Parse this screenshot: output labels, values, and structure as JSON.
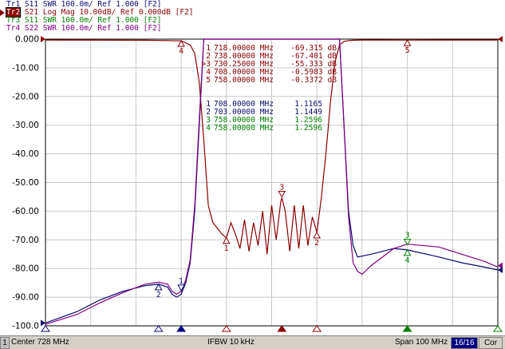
{
  "traces": [
    {
      "id": "Tr1",
      "param": "S11",
      "text": "SWR 100.0m/ Ref 1.000 [F2]",
      "color": "#0a0a6e",
      "active": false
    },
    {
      "id": "Tr2",
      "param": "S21",
      "text": "Log Mag 10.00dB/ Ref 0.000dB [F2]",
      "color": "#8b0000",
      "active": true
    },
    {
      "id": "Tr3",
      "param": "S11",
      "text": "SWR 100.0m/ Ref 1.000 [F2]",
      "color": "#008000",
      "active": false
    },
    {
      "id": "Tr4",
      "param": "S22",
      "text": "SWR 100.0m/ Ref 1.000 [F2]",
      "color": "#800080",
      "active": false
    }
  ],
  "markers_s21": [
    {
      "n": "1",
      "freq": "718.00000 MHz",
      "value": "-69.315 dB"
    },
    {
      "n": "2",
      "freq": "738.00000 MHz",
      "value": "-67.401 dB"
    },
    {
      "n": ">3",
      "freq": "730.25000 MHz",
      "value": "-55.333 dB"
    },
    {
      "n": "4",
      "freq": "708.00000 MHz",
      "value": "-0.5983 dB"
    },
    {
      "n": "5",
      "freq": "758.00000 MHz",
      "value": "-0.3372 dB"
    }
  ],
  "markers_s11": [
    {
      "n": "1",
      "freq": "708.00000 MHz",
      "value": "1.1165",
      "color": "#0a0a6e"
    },
    {
      "n": "2",
      "freq": "703.00000 MHz",
      "value": "1.1449",
      "color": "#0a0a6e"
    },
    {
      "n": "3",
      "freq": "758.00000 MHz",
      "value": "1.2596",
      "color": "#008000"
    },
    {
      "n": "4",
      "freq": "758.00000 MHz",
      "value": "1.2596",
      "color": "#008000"
    }
  ],
  "chart_data": {
    "type": "line",
    "x_range_mhz": [
      678,
      778
    ],
    "ylim": [
      -100,
      0
    ],
    "y_ticks": [
      "0.000",
      "-10.00",
      "-20.00",
      "-30.00",
      "-40.00",
      "-50.00",
      "-60.00",
      "-70.00",
      "-80.00",
      "-90.00",
      "-100.0"
    ],
    "grid": true,
    "series": [
      {
        "name": "Tr2 S21",
        "color": "#8b0000",
        "x": [
          678,
          700,
          705,
          708,
          710,
          711,
          712,
          713,
          714,
          715,
          716,
          717,
          718,
          719,
          720,
          721,
          722,
          723,
          724,
          725,
          726,
          727,
          728,
          729,
          730,
          730.25,
          731,
          732,
          733,
          734,
          735,
          736,
          737,
          738,
          739,
          740,
          741,
          742,
          743,
          744,
          745,
          746,
          748,
          752,
          758,
          765,
          770,
          778
        ],
        "y": [
          -0.3,
          -0.4,
          -0.5,
          -0.6,
          -2,
          -5,
          -15,
          -35,
          -58,
          -64,
          -66,
          -68,
          -69.3,
          -64,
          -68,
          -73,
          -63,
          -74,
          -64,
          -72,
          -60,
          -75,
          -58,
          -70,
          -57,
          -55.3,
          -60,
          -74,
          -58,
          -73,
          -58,
          -72,
          -62,
          -67.4,
          -55,
          -40,
          -22,
          -8,
          -2,
          -0.8,
          -0.5,
          -0.4,
          -0.3,
          -0.3,
          -0.34,
          -0.3,
          -0.3,
          -0.3
        ]
      },
      {
        "name": "Tr1 S11",
        "color": "#0a0a6e",
        "x": [
          678,
          685,
          690,
          695,
          700,
          703,
          705,
          706,
          707,
          708,
          709,
          710,
          711,
          712,
          713,
          743,
          744,
          745,
          746,
          747,
          750,
          755,
          758,
          765,
          770,
          775,
          778
        ],
        "y": [
          -99,
          -95,
          -91,
          -88,
          -86,
          -85.5,
          -86.5,
          -89,
          -90,
          -89,
          -85,
          -78,
          -60,
          -30,
          0,
          0,
          -30,
          -60,
          -72,
          -76,
          -75,
          -73,
          -73.5,
          -76,
          -78,
          -79.5,
          -80.5
        ]
      },
      {
        "name": "Tr3 S11",
        "color": "#008000",
        "x": [
          758
        ],
        "y": [
          -74
        ]
      },
      {
        "name": "Tr4 S22",
        "color": "#800080",
        "x": [
          678,
          685,
          690,
          695,
          700,
          703,
          705,
          706,
          707,
          708,
          709,
          710,
          711,
          712,
          713,
          743,
          744,
          745,
          746,
          747,
          748,
          750,
          755,
          758,
          765,
          770,
          775,
          778
        ],
        "y": [
          -99.5,
          -96,
          -92,
          -88.5,
          -85.5,
          -84.8,
          -85.5,
          -88,
          -89,
          -88,
          -84,
          -77,
          -58,
          -28,
          0,
          0,
          -30,
          -62,
          -78,
          -81,
          -82,
          -79,
          -73,
          -71.5,
          -72.5,
          -75,
          -77.5,
          -79.5
        ]
      }
    ]
  },
  "status": {
    "channel": "1",
    "center": "Center 728 MHz",
    "ifbw": "IFBW 10 kHz",
    "span": "Span 100 MHz",
    "count": "16/16",
    "cor": "Cor"
  }
}
